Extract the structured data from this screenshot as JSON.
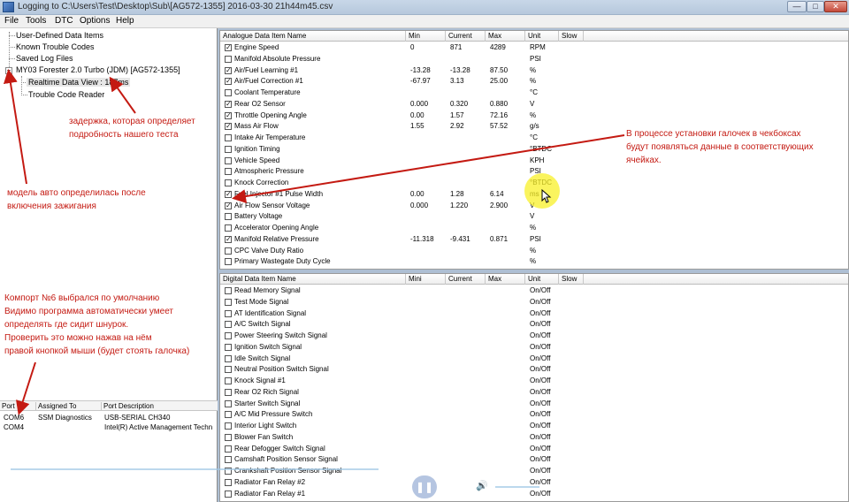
{
  "window": {
    "title": "Logging to C:\\Users\\Test\\Desktop\\Sub\\[AG572-1355] 2016-03-30 21h44m45.csv",
    "minimize": "—",
    "maximize": "□",
    "close": "✕"
  },
  "menu": [
    "File",
    "Tools",
    "DTC",
    "Options",
    "Help"
  ],
  "tree": {
    "items": [
      "User-Defined Data Items",
      "Known Trouble Codes",
      "Saved Log Files",
      "MY03 Forester 2.0 Turbo (JDM) [AG572-1355]",
      "Realtime Data View : 187ms",
      "Trouble Code Reader"
    ],
    "expander": "−"
  },
  "ports": {
    "headers": [
      "Port",
      "Assigned To",
      "Port Description"
    ],
    "rows": [
      [
        "COM6",
        "SSM Diagnostics",
        "USB-SERIAL CH340"
      ],
      [
        "COM4",
        "",
        "Intel(R) Active Management Techn"
      ]
    ]
  },
  "analogue": {
    "headers": [
      "Analogue Data Item Name",
      "Min",
      "Current",
      "Max",
      "Unit",
      "Slow"
    ],
    "rows": [
      {
        "checked": true,
        "name": "Engine Speed",
        "min": "0",
        "current": "871",
        "max": "4289",
        "unit": "RPM"
      },
      {
        "checked": false,
        "name": "Manifold Absolute Pressure",
        "min": "",
        "current": "",
        "max": "",
        "unit": "PSI"
      },
      {
        "checked": true,
        "name": "Air/Fuel Learning #1",
        "min": "-13.28",
        "current": "-13.28",
        "max": "87.50",
        "unit": "%"
      },
      {
        "checked": true,
        "name": "Air/Fuel Correction #1",
        "min": "-67.97",
        "current": "3.13",
        "max": "25.00",
        "unit": "%"
      },
      {
        "checked": false,
        "name": "Coolant Temperature",
        "min": "",
        "current": "",
        "max": "",
        "unit": "°C"
      },
      {
        "checked": true,
        "name": "Rear O2 Sensor",
        "min": "0.000",
        "current": "0.320",
        "max": "0.880",
        "unit": "V"
      },
      {
        "checked": true,
        "name": "Throttle Opening Angle",
        "min": "0.00",
        "current": "1.57",
        "max": "72.16",
        "unit": "%"
      },
      {
        "checked": true,
        "name": "Mass Air Flow",
        "min": "1.55",
        "current": "2.92",
        "max": "57.52",
        "unit": "g/s"
      },
      {
        "checked": false,
        "name": "Intake Air Temperature",
        "min": "",
        "current": "",
        "max": "",
        "unit": "°C"
      },
      {
        "checked": false,
        "name": "Ignition Timing",
        "min": "",
        "current": "",
        "max": "",
        "unit": "°BTDC"
      },
      {
        "checked": false,
        "name": "Vehicle Speed",
        "min": "",
        "current": "",
        "max": "",
        "unit": "KPH"
      },
      {
        "checked": false,
        "name": "Atmospheric Pressure",
        "min": "",
        "current": "",
        "max": "",
        "unit": "PSI"
      },
      {
        "checked": false,
        "name": "Knock Correction",
        "min": "",
        "current": "",
        "max": "",
        "unit": "°BTDC"
      },
      {
        "checked": true,
        "name": "Fuel Injector #1 Pulse Width",
        "min": "0.00",
        "current": "1.28",
        "max": "6.14",
        "unit": "ms"
      },
      {
        "checked": true,
        "name": "Air Flow Sensor Voltage",
        "min": "0.000",
        "current": "1.220",
        "max": "2.900",
        "unit": "V"
      },
      {
        "checked": false,
        "name": "Battery Voltage",
        "min": "",
        "current": "",
        "max": "",
        "unit": "V"
      },
      {
        "checked": false,
        "name": "Accelerator Opening Angle",
        "min": "",
        "current": "",
        "max": "",
        "unit": "%"
      },
      {
        "checked": true,
        "name": "Manifold Relative Pressure",
        "min": "-11.318",
        "current": "-9.431",
        "max": "0.871",
        "unit": "PSI"
      },
      {
        "checked": false,
        "name": "CPC Valve Duty Ratio",
        "min": "",
        "current": "",
        "max": "",
        "unit": "%"
      },
      {
        "checked": false,
        "name": "Primary Wastegate Duty Cycle",
        "min": "",
        "current": "",
        "max": "",
        "unit": "%"
      }
    ]
  },
  "digital": {
    "headers": [
      "Digital Data Item Name",
      "Mini",
      "Current",
      "Max",
      "Unit",
      "Slow"
    ],
    "rows": [
      {
        "checked": false,
        "name": "Read Memory Signal",
        "unit": "On/Off"
      },
      {
        "checked": false,
        "name": "Test Mode Signal",
        "unit": "On/Off"
      },
      {
        "checked": false,
        "name": "AT Identification Signal",
        "unit": "On/Off"
      },
      {
        "checked": false,
        "name": "A/C Switch Signal",
        "unit": "On/Off"
      },
      {
        "checked": false,
        "name": "Power Steering Switch Signal",
        "unit": "On/Off"
      },
      {
        "checked": false,
        "name": "Ignition Switch Signal",
        "unit": "On/Off"
      },
      {
        "checked": false,
        "name": "Idle Switch Signal",
        "unit": "On/Off"
      },
      {
        "checked": false,
        "name": "Neutral Position Switch Signal",
        "unit": "On/Off"
      },
      {
        "checked": false,
        "name": "Knock Signal #1",
        "unit": "On/Off"
      },
      {
        "checked": false,
        "name": "Rear O2 Rich Signal",
        "unit": "On/Off"
      },
      {
        "checked": false,
        "name": "Starter Switch Signal",
        "unit": "On/Off"
      },
      {
        "checked": false,
        "name": "A/C Mid Pressure Switch",
        "unit": "On/Off"
      },
      {
        "checked": false,
        "name": "Interior Light Switch",
        "unit": "On/Off"
      },
      {
        "checked": false,
        "name": "Blower Fan Switch",
        "unit": "On/Off"
      },
      {
        "checked": false,
        "name": "Rear Defogger Switch Signal",
        "unit": "On/Off"
      },
      {
        "checked": false,
        "name": "Camshaft Position Sensor Signal",
        "unit": "On/Off"
      },
      {
        "checked": false,
        "name": "Crankshaft Position Sensor Signal",
        "unit": "On/Off"
      },
      {
        "checked": false,
        "name": "Radiator Fan Relay #2",
        "unit": "On/Off"
      },
      {
        "checked": false,
        "name": "Radiator Fan Relay #1",
        "unit": "On/Off"
      }
    ]
  },
  "annotations": {
    "delay": "задержка, которая определяет\nподробность нашего теста",
    "model": "модель авто определилась после\nвключения зажигания",
    "comport": "Компорт №6 выбрался по умолчанию\nВидимо программа автоматически умеет\nопределять где сидит шнурок.\nПроверить это можно нажав на нём\nправой кнопкой мыши (будет стоять галочка)",
    "checkboxes": "В процессе установки галочек в чекбоксах\nбудут появляться данные в соответствующих\nячейках.",
    "color": "#c41a12"
  },
  "media_controls": {
    "shuffle": "⤮",
    "repeat": "↻",
    "stop": "■",
    "prev": "⏮",
    "play_pause": "❚❚",
    "next": "⏭",
    "volume": "🔊",
    "fullscreen": "⤢"
  }
}
